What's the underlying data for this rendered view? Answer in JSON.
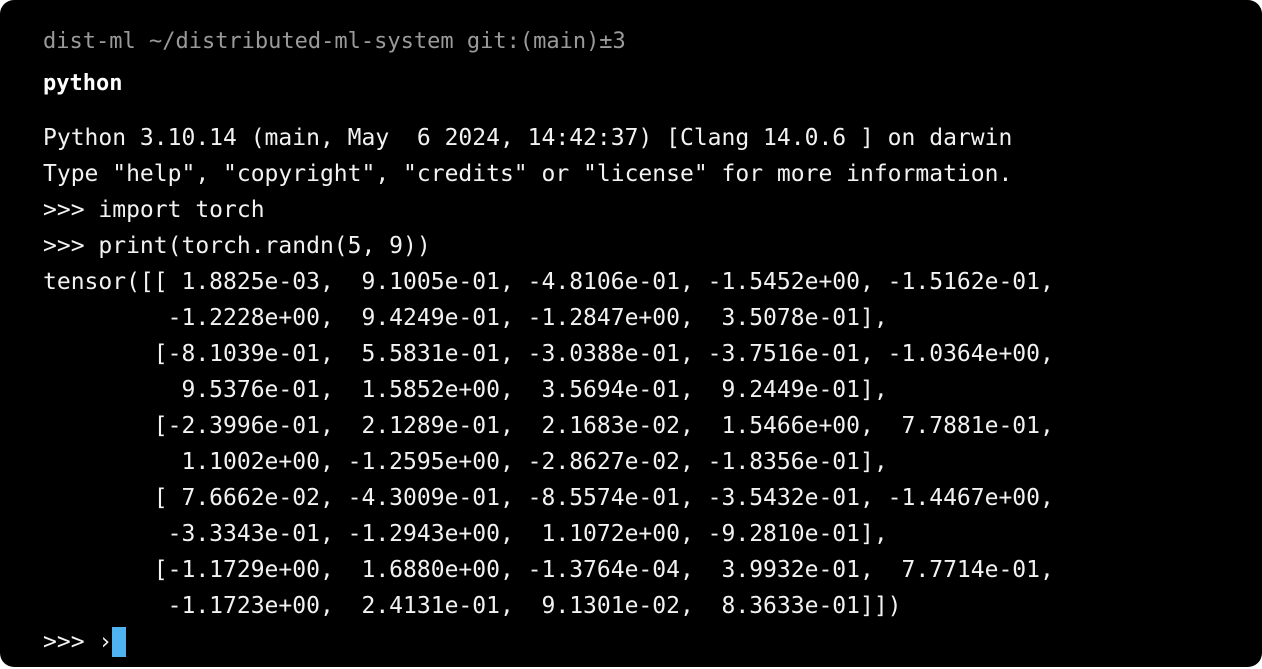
{
  "prompt": {
    "env": "dist-ml",
    "cwd": "~/distributed-ml-system",
    "git": "git:(main)±3",
    "command": "python"
  },
  "output": {
    "lines": [
      "Python 3.10.14 (main, May  6 2024, 14:42:37) [Clang 14.0.6 ] on darwin",
      "Type \"help\", \"copyright\", \"credits\" or \"license\" for more information.",
      ">>> import torch",
      ">>> print(torch.randn(5, 9))",
      "tensor([[ 1.8825e-03,  9.1005e-01, -4.8106e-01, -1.5452e+00, -1.5162e-01,",
      "         -1.2228e+00,  9.4249e-01, -1.2847e+00,  3.5078e-01],",
      "        [-8.1039e-01,  5.5831e-01, -3.0388e-01, -3.7516e-01, -1.0364e+00,",
      "          9.5376e-01,  1.5852e+00,  3.5694e-01,  9.2449e-01],",
      "        [-2.3996e-01,  2.1289e-01,  2.1683e-02,  1.5466e+00,  7.7881e-01,",
      "          1.1002e+00, -1.2595e+00, -2.8627e-02, -1.8356e-01],",
      "        [ 7.6662e-02, -4.3009e-01, -8.5574e-01, -3.5432e-01, -1.4467e+00,",
      "         -3.3343e-01, -1.2943e+00,  1.1072e+00, -9.2810e-01],",
      "        [-1.1729e+00,  1.6880e+00, -1.3764e-04,  3.9932e-01,  7.7714e-01,",
      "         -1.1723e+00,  2.4131e-01,  9.1301e-02,  8.3633e-01]])"
    ],
    "repl_prompt": ">>> ",
    "repl_caret": "›"
  },
  "colors": {
    "background": "#000000",
    "prompt_text": "#9a9a9a",
    "text": "#f2f2f2",
    "cursor": "#4fb3f2"
  }
}
